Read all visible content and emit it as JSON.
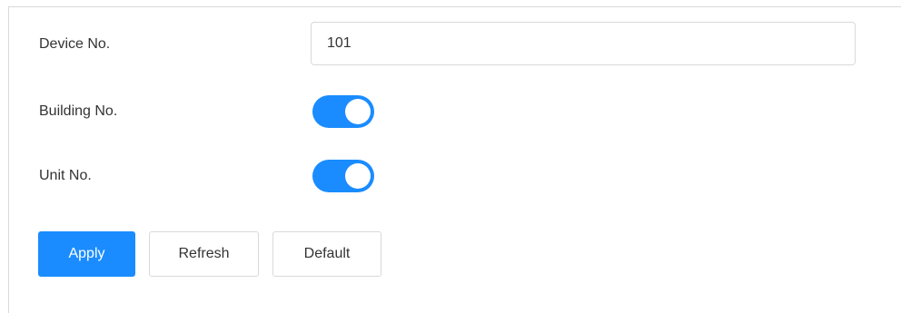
{
  "form": {
    "device_no": {
      "label": "Device No.",
      "value": "101"
    },
    "building_no": {
      "label": "Building No.",
      "enabled": true
    },
    "unit_no": {
      "label": "Unit No.",
      "enabled": true
    }
  },
  "actions": {
    "apply_label": "Apply",
    "refresh_label": "Refresh",
    "default_label": "Default"
  },
  "colors": {
    "accent": "#1a8cff",
    "border": "#d9d9d9",
    "text": "#333333"
  }
}
